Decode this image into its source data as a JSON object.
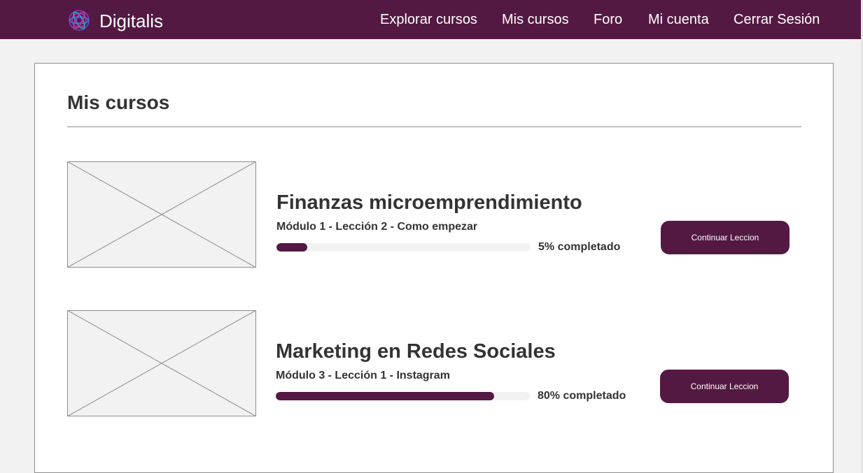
{
  "brand": {
    "name": "Digitalis",
    "logo_icon": "flower-mandala-icon",
    "logo_colors": [
      "#7b3fc4",
      "#c23aa8",
      "#3a7bd5",
      "#1fb5c9"
    ]
  },
  "nav": {
    "items": [
      {
        "label": "Explorar cursos"
      },
      {
        "label": "Mis cursos"
      },
      {
        "label": "Foro"
      },
      {
        "label": "Mi cuenta"
      },
      {
        "label": "Cerrar Sesión"
      }
    ]
  },
  "main": {
    "title": "Mis cursos",
    "courses": [
      {
        "title": "Finanzas microemprendimiento",
        "subtitle": "Módulo 1 - Lección 2 - Como empezar",
        "progress_percent": 12,
        "progress_text": "5% completado",
        "button_label": "Continuar Leccion",
        "thumbnail_icon": "image-placeholder-icon"
      },
      {
        "title": "Marketing en Redes Sociales",
        "subtitle": "Módulo 3 - Lección 1 - Instagram",
        "progress_percent": 86,
        "progress_text": "80% completado",
        "button_label": "Continuar Leccion",
        "thumbnail_icon": "image-placeholder-icon"
      }
    ]
  },
  "colors": {
    "brand": "#541943",
    "page_background": "#f2f2f2",
    "card_background": "#ffffff",
    "text": "#333333",
    "progress_track": "#f2f2f2",
    "border": "#8c8c8c"
  }
}
